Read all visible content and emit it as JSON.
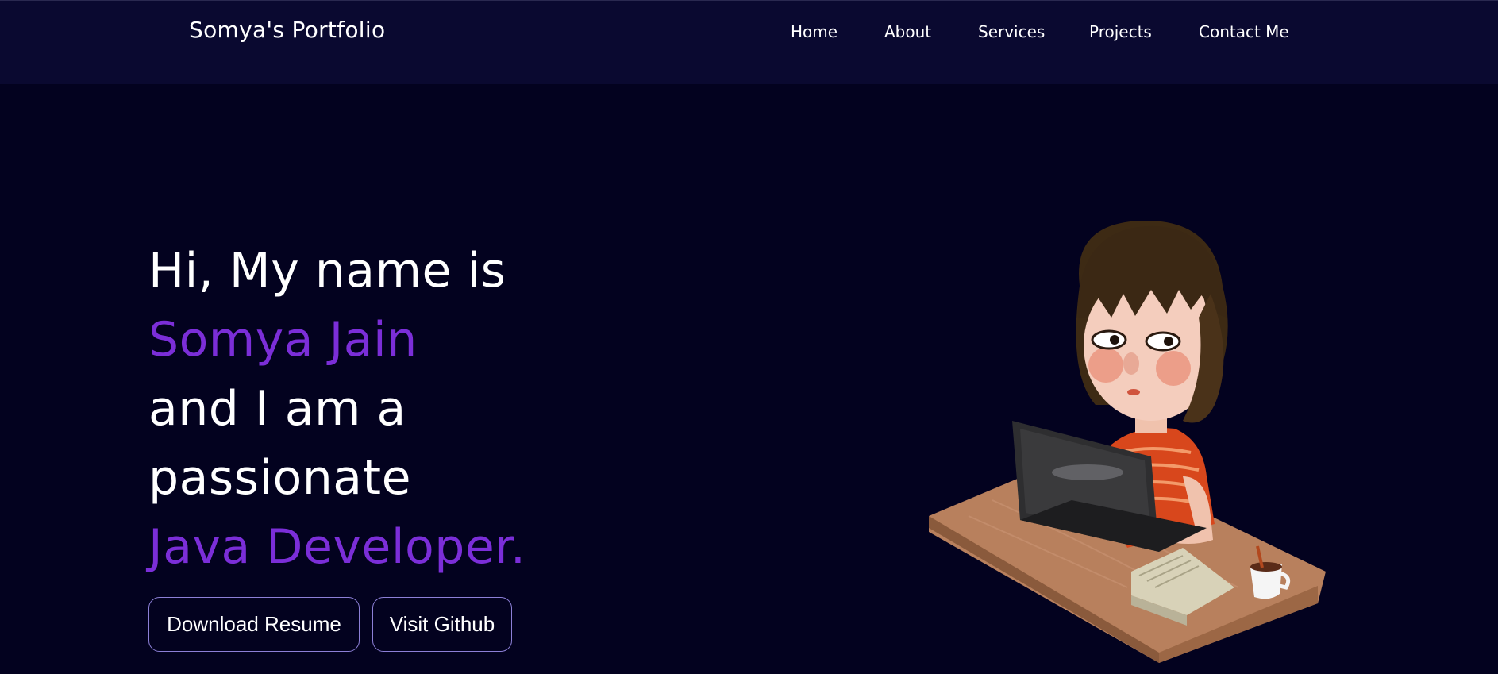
{
  "navbar": {
    "brand": "Somya's Portfolio",
    "links": [
      "Home",
      "About",
      "Services",
      "Projects",
      "Contact Me"
    ]
  },
  "hero": {
    "lines": [
      {
        "text": "Hi, My name is",
        "accent": false
      },
      {
        "text": "Somya Jain",
        "accent": true
      },
      {
        "text": "and I am a",
        "accent": false
      },
      {
        "text": "passionate",
        "accent": false
      },
      {
        "text": "Java Developer.",
        "accent": true
      }
    ],
    "download_label": "Download Resume",
    "github_label": "Visit Github"
  },
  "colors": {
    "background": "#03021f",
    "navbar": "#0a0930",
    "accent": "#7b2ed8",
    "button_border": "#8c7fd6"
  },
  "illustration": {
    "icon": "girl-at-laptop-illustration"
  }
}
